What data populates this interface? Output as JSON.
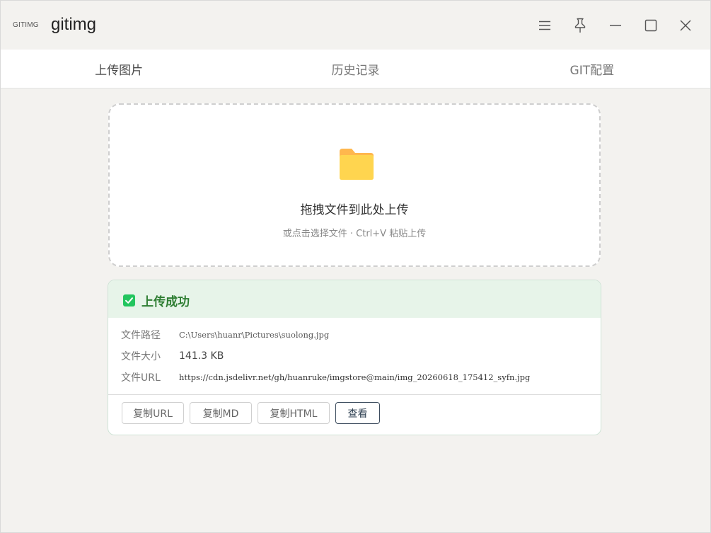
{
  "app": {
    "logo_text": "GITIMG",
    "title": "gitimg"
  },
  "titlebar": {
    "icons": [
      "menu-icon",
      "pin-icon",
      "minimize-icon",
      "maximize-icon",
      "close-icon"
    ]
  },
  "tabs": [
    {
      "label": "上传图片",
      "active": true
    },
    {
      "label": "历史记录",
      "active": false
    },
    {
      "label": "GIT配置",
      "active": false
    }
  ],
  "dropzone": {
    "icon": "folder-icon",
    "main_text": "拖拽文件到此处上传",
    "sub_text": "或点击选择文件 · Ctrl+V 粘贴上传"
  },
  "result": {
    "title": "上传成功",
    "rows": [
      {
        "label": "文件路径",
        "value": "C:\\Users\\huanr\\Pictures\\suolong.jpg"
      },
      {
        "label": "文件大小",
        "value": "141.3 KB"
      },
      {
        "label": "文件URL",
        "value": "https://cdn.jsdelivr.net/gh/huanruke/imgstore@main/img_20260618_175412_syfn.jpg"
      }
    ],
    "buttons": {
      "copy_url": "复制URL",
      "copy_md": "复制MD",
      "copy_html": "复制HTML",
      "view": "查看"
    }
  },
  "colors": {
    "success_bg": "#e7f4e9",
    "success_text": "#2e7d32",
    "check_green": "#22c55e",
    "folder_yellow": "#ffd54f",
    "folder_tab": "#ffb74d"
  }
}
